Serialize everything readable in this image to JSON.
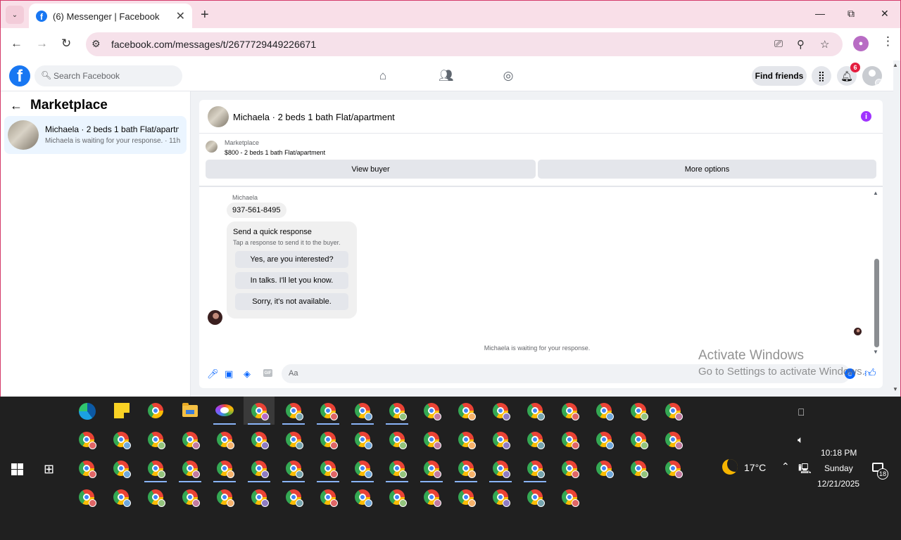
{
  "browser": {
    "tab_title": "(6) Messenger | Facebook",
    "tab_close": "✕",
    "new_tab": "+",
    "url": "facebook.com/messages/t/2677729449226671",
    "window_controls": {
      "minimize": "—",
      "maximize": "⧉",
      "close": "✕"
    }
  },
  "fb_header": {
    "search_placeholder": "Search Facebook",
    "find_friends_label": "Find friends",
    "notification_count": "6",
    "nav_icons": [
      "home-icon",
      "friends-icon",
      "groups-icon"
    ]
  },
  "sidebar": {
    "title": "Marketplace",
    "conversations": [
      {
        "name": "Michaela · 2 beds 1 bath Flat/apartment",
        "subtitle": "Michaela is waiting for your response. · 11h"
      }
    ]
  },
  "chat": {
    "title": "Michaela · 2 beds 1 bath Flat/apartment",
    "listing_label": "Marketplace",
    "listing_detail": "$800 - 2 beds 1 bath Flat/apartment",
    "view_buyer_label": "View buyer",
    "more_options_label": "More options",
    "sender_name": "Michaela",
    "message_text": "937-561-8495",
    "quick_response": {
      "title": "Send a quick response",
      "subtitle": "Tap a response to send it to the buyer.",
      "options": [
        "Yes, are you interested?",
        "In talks. I'll let you know.",
        "Sorry, it's not available."
      ]
    },
    "waiting_text": "Michaela is waiting for your response.",
    "composer_placeholder": "Aa"
  },
  "watermark": {
    "line1": "Activate Windows",
    "line2": "Go to Settings to activate Windows."
  },
  "taskbar": {
    "weather_temp": "17°C",
    "time": "10:18 PM",
    "day": "Sunday",
    "date": "12/21/2025",
    "notification_count": "18"
  },
  "colors": {
    "facebook_blue": "#1877f2",
    "messenger_blue": "#0866ff",
    "notification_red": "#e41e3f",
    "tab_bar_pink": "#f9dfe8"
  }
}
